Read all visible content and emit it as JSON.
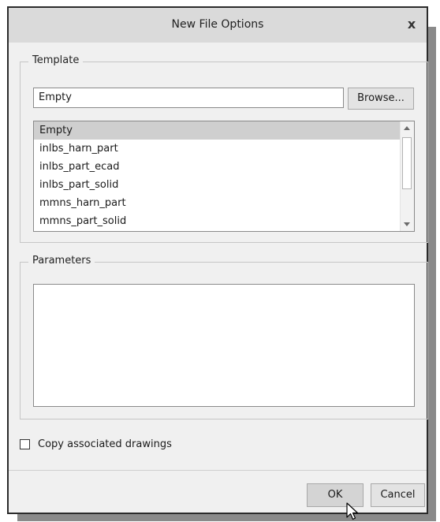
{
  "dialog": {
    "title": "New File Options",
    "close_glyph": "x"
  },
  "template": {
    "legend": "Template",
    "input_value": "Empty",
    "browse_label": "Browse...",
    "items": [
      {
        "label": "Empty",
        "selected": true
      },
      {
        "label": "inlbs_harn_part",
        "selected": false
      },
      {
        "label": "inlbs_part_ecad",
        "selected": false
      },
      {
        "label": "inlbs_part_solid",
        "selected": false
      },
      {
        "label": "mmns_harn_part",
        "selected": false
      },
      {
        "label": "mmns_part_solid",
        "selected": false
      }
    ]
  },
  "parameters": {
    "legend": "Parameters"
  },
  "options": {
    "copy_drawings_label": "Copy associated drawings",
    "copy_drawings_checked": false
  },
  "buttons": {
    "ok_label": "OK",
    "cancel_label": "Cancel"
  },
  "icons": {
    "close": "close-icon",
    "cursor": "mouse-pointer-icon",
    "scroll_up": "chevron-up-icon",
    "scroll_down": "chevron-down-icon"
  }
}
